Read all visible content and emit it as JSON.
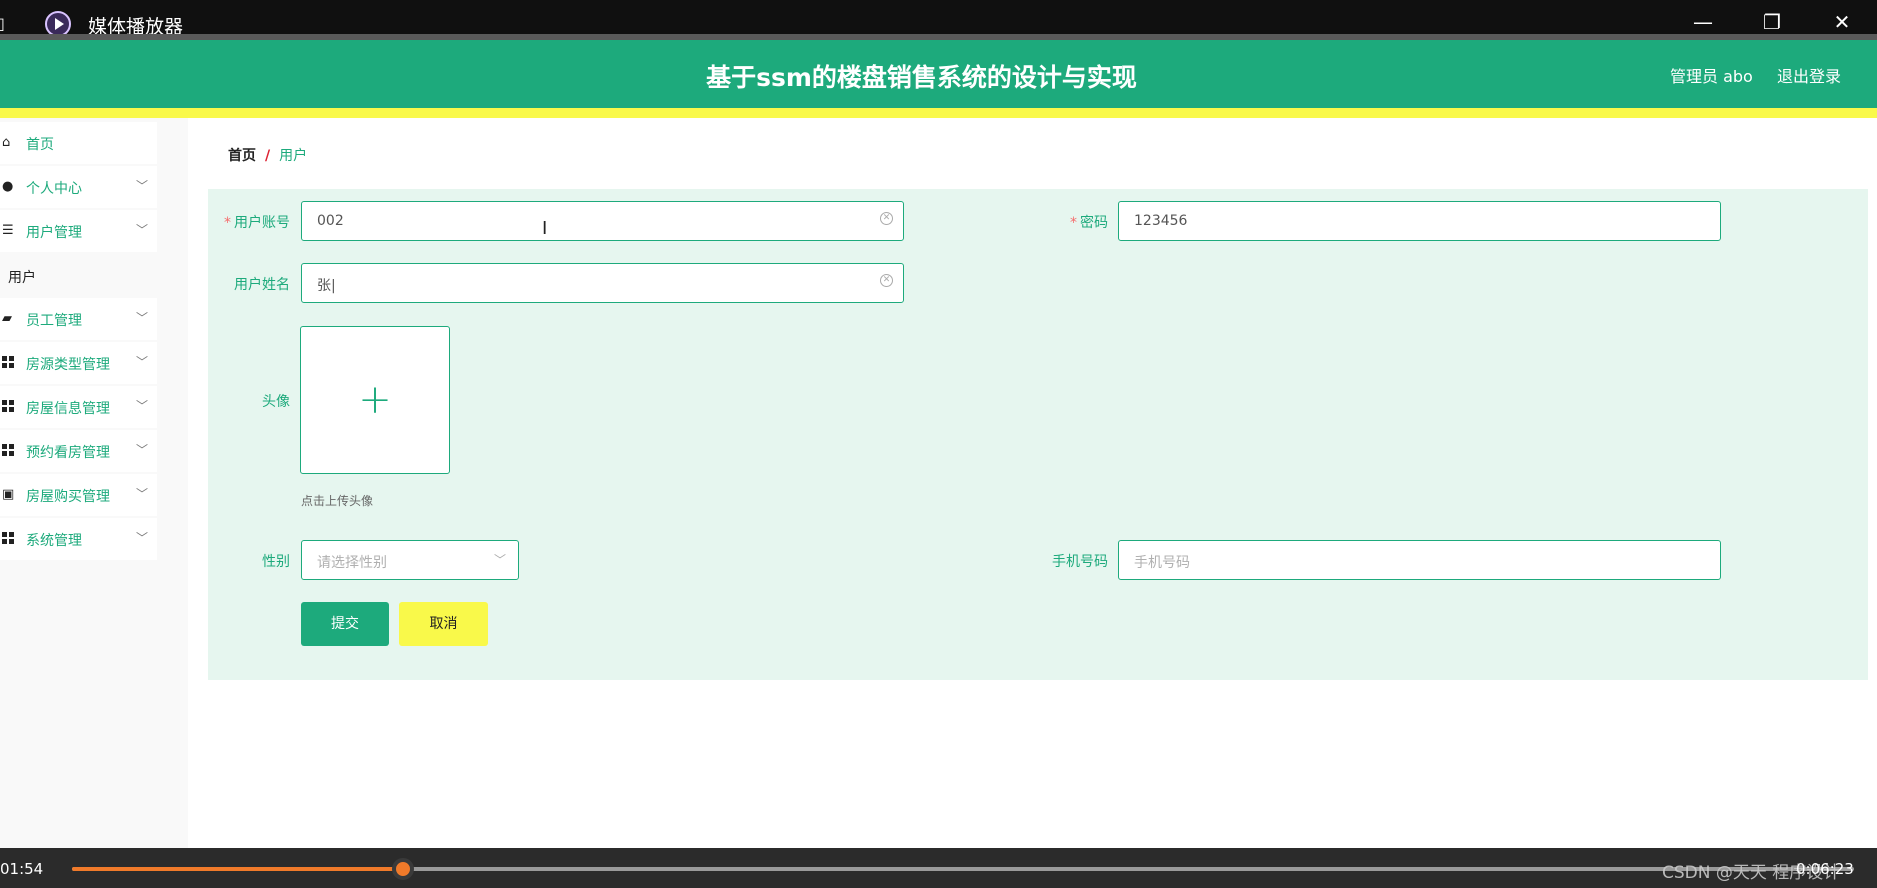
{
  "window": {
    "title": "媒体播放器",
    "left_glyph": "▯"
  },
  "header": {
    "title": "基于ssm的楼盘销售系统的设计与实现",
    "admin": "管理员 abo",
    "logout": "退出登录"
  },
  "sidebar": {
    "items": [
      {
        "label": "首页",
        "icon": "home-icon"
      },
      {
        "label": "个人中心",
        "icon": "user-icon"
      },
      {
        "label": "用户管理",
        "icon": "sliders-icon"
      },
      {
        "label": "用户",
        "icon": ""
      },
      {
        "label": "员工管理",
        "icon": "briefcase-icon"
      },
      {
        "label": "房源类型管理",
        "icon": "grid-icon"
      },
      {
        "label": "房屋信息管理",
        "icon": "grid-icon"
      },
      {
        "label": "预约看房管理",
        "icon": "grid-icon"
      },
      {
        "label": "房屋购买管理",
        "icon": "chart-icon"
      },
      {
        "label": "系统管理",
        "icon": "grid-icon"
      }
    ]
  },
  "breadcrumb": {
    "home": "首页",
    "separator": "/",
    "current": "用户"
  },
  "form": {
    "account": {
      "label": "用户账号",
      "value": "002"
    },
    "password": {
      "label": "密码",
      "value": "123456"
    },
    "name": {
      "label": "用户姓名",
      "value": "张|"
    },
    "avatar": {
      "label": "头像",
      "tip": "点击上传头像"
    },
    "gender": {
      "label": "性别",
      "placeholder": "请选择性别"
    },
    "phone": {
      "label": "手机号码",
      "placeholder": "手机号码"
    },
    "submit": "提交",
    "cancel": "取消"
  },
  "player": {
    "elapsed": "01:54",
    "total": "0:06:23",
    "progress_fraction": 0.186,
    "watermark": "CSDN @天天 程序设计"
  },
  "colors": {
    "accent": "#1daa7c",
    "yellow": "#f9f94a",
    "progress": "#f07a2a"
  }
}
